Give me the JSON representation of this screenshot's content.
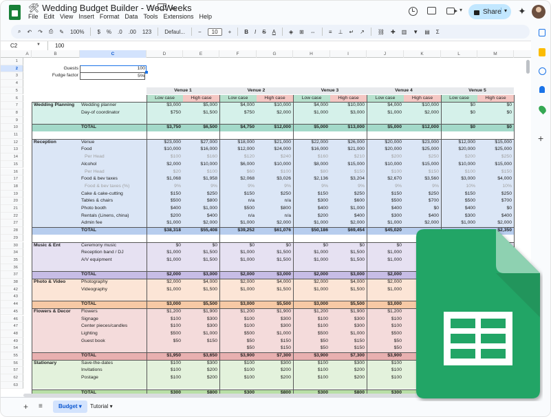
{
  "app": {
    "title": "🛠 Wedding Budget Builder - WedWeeks",
    "menus": [
      "File",
      "Edit",
      "View",
      "Insert",
      "Format",
      "Data",
      "Tools",
      "Extensions",
      "Help"
    ],
    "share_label": "Share",
    "accent_color": "#c2e7ff",
    "brand_color": "#188038"
  },
  "toolbar": {
    "zoom": "100%",
    "currency": "$",
    "percent": "%",
    "dec_less": ".0",
    "dec_more": ".00",
    "number_format": "123",
    "font": "Defaul...",
    "font_size": "10",
    "bold": "B",
    "italic": "I",
    "strike": "S",
    "text_color": "A",
    "sum": "Σ"
  },
  "formula_bar": {
    "cell_ref": "C2",
    "fx": "fx",
    "value": "100"
  },
  "columns": [
    "A",
    "B",
    "C",
    "D",
    "E",
    "F",
    "G",
    "H",
    "I",
    "J",
    "K",
    "L",
    "M"
  ],
  "row_numbers": [
    "1",
    "2",
    "3",
    "4",
    "5",
    "6",
    "7",
    "8",
    "9",
    "10",
    "11",
    "12",
    "13",
    "14",
    "15",
    "16",
    "17",
    "18",
    "19",
    "20",
    "21",
    "22",
    "27",
    "28",
    "29",
    "30",
    "34",
    "35",
    "36",
    "37",
    "38",
    "42",
    "43",
    "44",
    "45",
    "46",
    "47",
    "48",
    "49",
    "54",
    "55",
    "56",
    "57",
    "62",
    "63"
  ],
  "inputs": {
    "guests_label": "Guests",
    "guests_value": "100",
    "fudge_label": "Fudge factor",
    "fudge_value": "5%"
  },
  "venues": [
    "Venue 1",
    "Venue 2",
    "Venue 3",
    "Venue 4",
    "Venue 5"
  ],
  "case_labels": {
    "low": "Low case",
    "high": "High case"
  },
  "sections": [
    {
      "name": "Wedding Planning",
      "color": "#d5f1ea",
      "total_color": "#a3d9c9",
      "rows": [
        {
          "item": "Wedding planner",
          "v": [
            "$3,000",
            "$5,000",
            "$4,000",
            "$10,000",
            "$4,000",
            "$10,000",
            "$4,000",
            "$10,000",
            "$0",
            "$0"
          ]
        },
        {
          "item": "Day-of coordinator",
          "v": [
            "$750",
            "$1,500",
            "$750",
            "$2,000",
            "$1,000",
            "$3,000",
            "$1,000",
            "$2,000",
            "$0",
            "$0"
          ]
        },
        {
          "item": "",
          "v": [
            "",
            "",
            "",
            "",
            "",
            "",
            "",
            "",
            "",
            ""
          ]
        }
      ],
      "total": [
        "$3,750",
        "$6,500",
        "$4,750",
        "$12,000",
        "$5,000",
        "$13,000",
        "$5,000",
        "$12,000",
        "$0",
        "$0"
      ]
    },
    {
      "name": "Reception",
      "color": "#dbe6f6",
      "total_color": "#b7cdee",
      "rows": [
        {
          "item": "Venue",
          "v": [
            "$23,000",
            "$27,000",
            "$18,000",
            "$21,000",
            "$22,000",
            "$26,000",
            "$20,000",
            "$23,000",
            "$12,000",
            "$15,000"
          ]
        },
        {
          "item": "Food",
          "v": [
            "$10,000",
            "$16,000",
            "$12,000",
            "$24,000",
            "$16,000",
            "$21,000",
            "$20,000",
            "$25,000",
            "$20,000",
            "$25,000"
          ]
        },
        {
          "item": "Per Head",
          "muted": true,
          "v": [
            "$100",
            "$160",
            "$120",
            "$240",
            "$160",
            "$210",
            "$200",
            "$250",
            "$200",
            "$250"
          ]
        },
        {
          "item": "Alcohol",
          "v": [
            "$2,000",
            "$10,000",
            "$6,000",
            "$10,000",
            "$8,000",
            "$15,000",
            "$10,000",
            "$15,000",
            "$10,000",
            "$15,000"
          ]
        },
        {
          "item": "Per Head",
          "muted": true,
          "v": [
            "$20",
            "$100",
            "$60",
            "$100",
            "$80",
            "$150",
            "$100",
            "$150",
            "$100",
            "$150"
          ]
        },
        {
          "item": "Food & bev taxes",
          "v": [
            "$1,068",
            "$1,958",
            "$2,068",
            "$3,026",
            "$2,136",
            "$3,204",
            "$2,670",
            "$3,560",
            "$3,000",
            "$4,000"
          ]
        },
        {
          "item": "Food & bev taxes (%)",
          "muted": true,
          "v": [
            "9%",
            "9%",
            "9%",
            "9%",
            "9%",
            "9%",
            "9%",
            "9%",
            "10%",
            "10%"
          ]
        },
        {
          "item": "Cake & cake-cutting",
          "v": [
            "$150",
            "$250",
            "$150",
            "$250",
            "$150",
            "$250",
            "$150",
            "$250",
            "$150",
            "$250"
          ]
        },
        {
          "item": "Tables & chairs",
          "v": [
            "$500",
            "$800",
            "n/a",
            "n/a",
            "$300",
            "$600",
            "$500",
            "$700",
            "$500",
            "$700"
          ]
        },
        {
          "item": "Photo booth",
          "v": [
            "$400",
            "$1,000",
            "$500",
            "$800",
            "$400",
            "$1,000",
            "$400",
            "$0",
            "$400",
            "$0"
          ]
        },
        {
          "item": "Rentals (Linens, china)",
          "v": [
            "$200",
            "$400",
            "n/a",
            "n/a",
            "$200",
            "$400",
            "$300",
            "$400",
            "$300",
            "$400"
          ]
        },
        {
          "item": "Admin fee",
          "v": [
            "$1,000",
            "$2,000",
            "$1,000",
            "$2,000",
            "$1,000",
            "$2,000",
            "$1,000",
            "$2,000",
            "$1,000",
            "$2,000"
          ]
        }
      ],
      "total": [
        "$38,318",
        "$55,408",
        "$39,252",
        "$61,076",
        "$50,186",
        "$69,454",
        "$45,020",
        "",
        "",
        "$2,350"
      ]
    },
    {
      "name": "Music & Ent",
      "color": "#e6e1f2",
      "total_color": "#c7bde6",
      "rows": [
        {
          "item": "Ceremony music",
          "v": [
            "$0",
            "$0",
            "$0",
            "$0",
            "$0",
            "$0",
            "$0",
            "",
            "",
            ""
          ]
        },
        {
          "item": "Reception band / DJ",
          "v": [
            "$1,000",
            "$1,500",
            "$1,000",
            "$1,500",
            "$1,000",
            "$1,500",
            "$1,000",
            "",
            "",
            ""
          ]
        },
        {
          "item": "A/V equipment",
          "v": [
            "$1,000",
            "$1,500",
            "$1,000",
            "$1,500",
            "$1,000",
            "$1,500",
            "$1,000",
            "",
            "",
            ""
          ]
        },
        {
          "item": "",
          "v": [
            "",
            "",
            "",
            "",
            "",
            "",
            "",
            "",
            "",
            ""
          ]
        }
      ],
      "total": [
        "$2,000",
        "$3,000",
        "$2,000",
        "$3,000",
        "$2,000",
        "$3,000",
        "$2,000",
        "",
        "",
        ""
      ]
    },
    {
      "name": "Photo & Video",
      "color": "#fce5d6",
      "total_color": "#f7c9a5",
      "rows": [
        {
          "item": "Photography",
          "v": [
            "$2,000",
            "$4,000",
            "$2,000",
            "$4,000",
            "$2,000",
            "$4,000",
            "$2,000",
            "",
            "",
            ""
          ]
        },
        {
          "item": "Videography",
          "v": [
            "$1,000",
            "$1,500",
            "$1,000",
            "$1,500",
            "$1,000",
            "$1,500",
            "$1,000",
            "",
            "",
            ""
          ]
        },
        {
          "item": "",
          "v": [
            "",
            "",
            "",
            "",
            "",
            "",
            "",
            "",
            "",
            ""
          ]
        }
      ],
      "total": [
        "$3,000",
        "$5,500",
        "$3,000",
        "$5,500",
        "$3,000",
        "$5,500",
        "$3,000",
        "",
        "",
        ""
      ]
    },
    {
      "name": "Flowers & Decor",
      "color": "#f4dbdb",
      "total_color": "#e8b0b0",
      "rows": [
        {
          "item": "Flowers",
          "v": [
            "$1,200",
            "$1,900",
            "$1,200",
            "$1,900",
            "$1,200",
            "$1,900",
            "$1,200",
            "",
            "",
            ""
          ]
        },
        {
          "item": "Signage",
          "v": [
            "$100",
            "$300",
            "$100",
            "$300",
            "$100",
            "$300",
            "$100",
            "",
            "",
            ""
          ]
        },
        {
          "item": "Center pieces/candles",
          "v": [
            "$100",
            "$300",
            "$100",
            "$300",
            "$100",
            "$300",
            "$100",
            "",
            "",
            ""
          ]
        },
        {
          "item": "Lighting",
          "v": [
            "$500",
            "$1,000",
            "$500",
            "$1,000",
            "$500",
            "$1,000",
            "$500",
            "",
            "",
            ""
          ]
        },
        {
          "item": "Guest book",
          "v": [
            "$50",
            "$150",
            "$50",
            "$150",
            "$50",
            "$150",
            "$50",
            "",
            "",
            ""
          ]
        },
        {
          "item": "",
          "v": [
            "",
            "",
            "$50",
            "$150",
            "$50",
            "$150",
            "$50",
            "",
            "",
            ""
          ]
        }
      ],
      "total": [
        "$1,950",
        "$3,650",
        "$3,900",
        "$7,300",
        "$3,900",
        "$7,300",
        "$3,900",
        "",
        "",
        ""
      ]
    },
    {
      "name": "Stationary",
      "color": "#e3f2dc",
      "total_color": "#b9dfa7",
      "rows": [
        {
          "item": "Save-the-dates",
          "v": [
            "$100",
            "$300",
            "$100",
            "$300",
            "$100",
            "$300",
            "$100",
            "",
            "",
            ""
          ]
        },
        {
          "item": "Invitations",
          "v": [
            "$100",
            "$200",
            "$100",
            "$200",
            "$100",
            "$200",
            "$100",
            "",
            "",
            ""
          ]
        },
        {
          "item": "Postage",
          "v": [
            "$100",
            "$200",
            "$100",
            "$200",
            "$100",
            "$200",
            "$100",
            "",
            "",
            ""
          ]
        },
        {
          "item": "",
          "v": [
            "",
            "",
            "",
            "",
            "",
            "",
            "",
            "",
            "",
            ""
          ]
        }
      ],
      "total": [
        "$300",
        "$800",
        "$300",
        "$800",
        "$300",
        "$800",
        "$300",
        "",
        "",
        ""
      ]
    }
  ],
  "total_label": "TOTAL",
  "sheets": [
    {
      "name": "Budget",
      "active": true
    },
    {
      "name": "Tutorial",
      "active": false
    }
  ]
}
